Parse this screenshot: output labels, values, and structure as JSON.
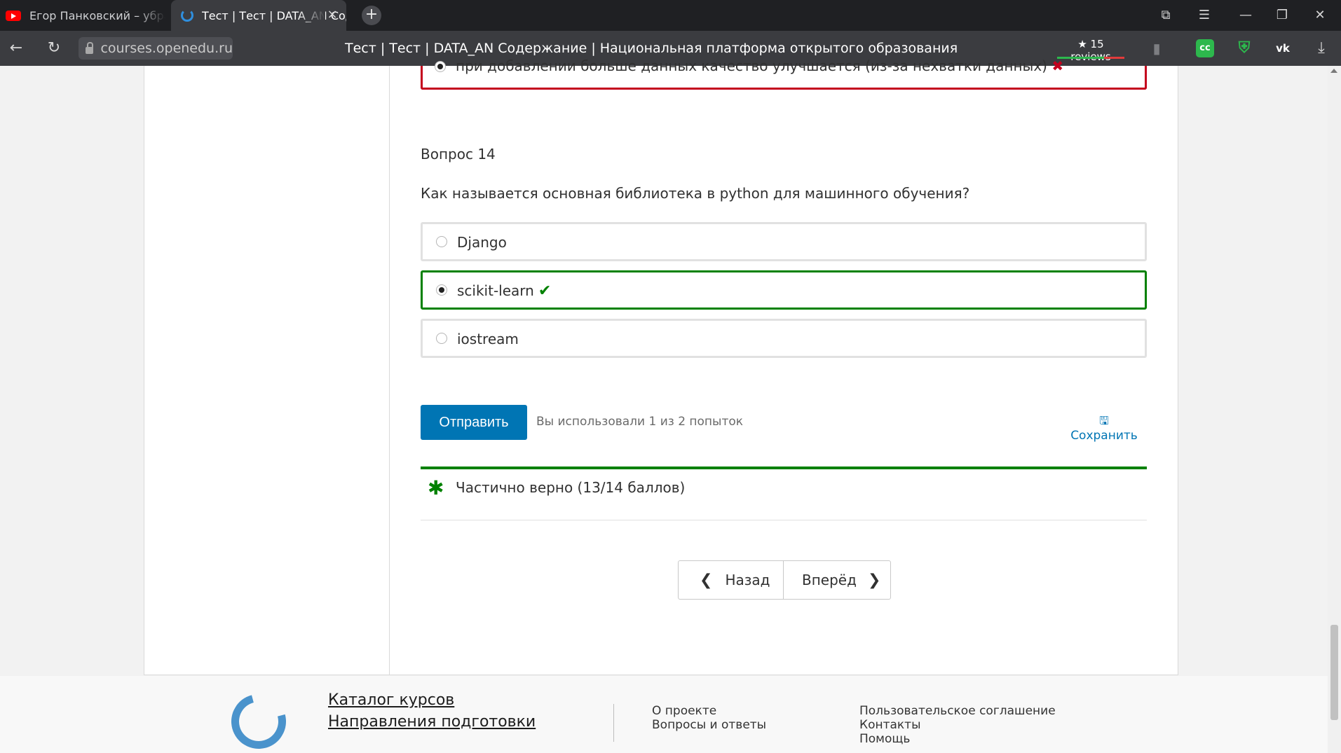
{
  "browser": {
    "tabs": [
      {
        "title": "Егор Панковский – убрать",
        "active": false,
        "icon": "youtube-icon"
      },
      {
        "title": "Тест | Тест | DATA_AN Содержание",
        "active": true,
        "icon": "loading-spinner-icon",
        "close": "×"
      }
    ],
    "new_tab": "+",
    "url": "courses.openedu.ru",
    "page_title": "Тест | Тест | DATA_AN Содержание | Национальная платформа открытого образования",
    "reviews": "★ 15 reviews",
    "extensions": [
      {
        "name": "cc-extension-icon",
        "label": "cc",
        "color": "#2db84d"
      },
      {
        "name": "shield-extension-icon",
        "label": "✓",
        "color": "#2db84d"
      },
      {
        "name": "vk-icon",
        "label": "vk",
        "color": "#ffffff"
      }
    ],
    "window_controls": {
      "minimize": "—",
      "maximize": "❐",
      "close": "✕",
      "menu": "☰",
      "collections": "⧉"
    }
  },
  "previous_question": {
    "selected_answer": "при добавлении больше данных качество улучшается (из-за нехватки данных)",
    "status_icon": "✖"
  },
  "question": {
    "number_label": "Вопрос 14",
    "text": "Как называется основная библиотека в python для машинного обучения?",
    "options": [
      {
        "label": "Django",
        "selected": false,
        "correct": null
      },
      {
        "label": "scikit-learn",
        "selected": true,
        "correct": true,
        "status_icon": "✔"
      },
      {
        "label": "iostream",
        "selected": false,
        "correct": null
      }
    ]
  },
  "actions": {
    "submit_label": "Отправить",
    "attempts_text": "Вы использовали 1 из 2 попыток",
    "save_label": "Сохранить"
  },
  "result": {
    "icon": "✱",
    "text": "Частично верно (13/14 баллов)"
  },
  "sequence_nav": {
    "prev_label": "Назад",
    "next_label": "Вперёд"
  },
  "footer": {
    "main_links": [
      "Каталог курсов",
      "Направления подготовки"
    ],
    "col1": [
      "О проекте",
      "Вопросы и ответы"
    ],
    "col2": [
      "Пользовательское соглашение",
      "Контакты",
      "Помощь"
    ]
  },
  "colors": {
    "accent": "#0075b4",
    "correct": "#008100",
    "incorrect": "#c4001d",
    "brand_logo": "#4a93cc"
  }
}
